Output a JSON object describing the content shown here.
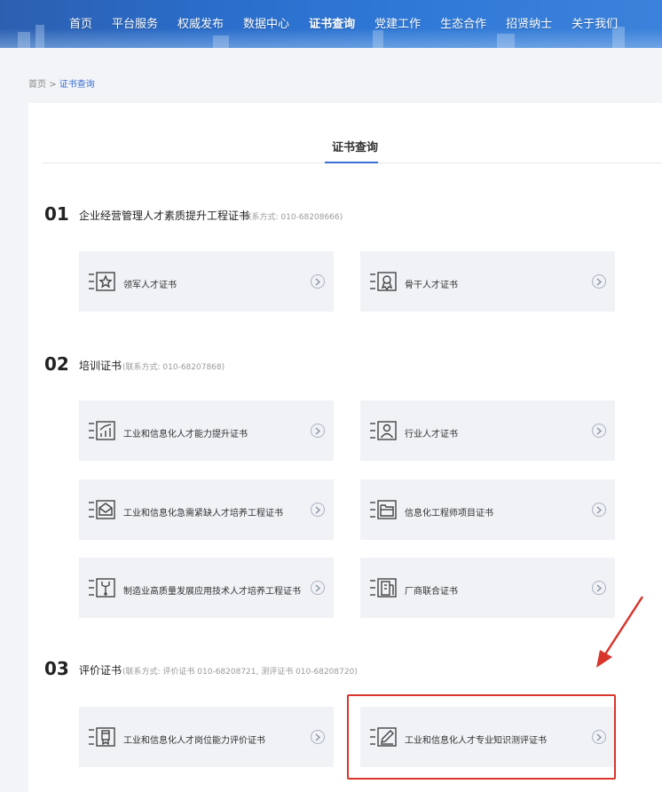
{
  "nav": {
    "items": [
      "首页",
      "平台服务",
      "权威发布",
      "数据中心",
      "证书查询",
      "党建工作",
      "生态合作",
      "招贤纳士",
      "关于我们"
    ],
    "active_index": 4
  },
  "breadcrumb": {
    "home": "首页",
    "sep": ">",
    "current": "证书查询"
  },
  "page_title": "证书查询",
  "sections": [
    {
      "num": "01",
      "title": "企业经营管理人才素质提升工程证书",
      "contact": "(联系方式: 010-68208666)",
      "cards": [
        {
          "label": "领军人才证书",
          "icon": "star-certificate-icon"
        },
        {
          "label": "骨干人才证书",
          "icon": "award-certificate-icon"
        }
      ]
    },
    {
      "num": "02",
      "title": "培训证书",
      "contact": "(联系方式: 010-68207868)",
      "cards": [
        {
          "label": "工业和信息化人才能力提升证书",
          "icon": "growth-chart-icon"
        },
        {
          "label": "行业人才证书",
          "icon": "person-icon"
        },
        {
          "label": "工业和信息化急需紧缺人才培养工程证书",
          "icon": "envelope-icon"
        },
        {
          "label": "信息化工程师项目证书",
          "icon": "folder-icon"
        },
        {
          "label": "制造业高质量发展应用技术人才培养工程证书",
          "icon": "wrench-icon"
        },
        {
          "label": "厂商联合证书",
          "icon": "building-icon"
        }
      ]
    },
    {
      "num": "03",
      "title": "评价证书",
      "contact": "(联系方式: 评价证书 010-68208721, 测评证书 010-68208720)",
      "cards": [
        {
          "label": "工业和信息化人才岗位能力评价证书",
          "icon": "badge-icon"
        },
        {
          "label": "工业和信息化人才专业知识测评证书",
          "icon": "pen-icon"
        }
      ]
    }
  ],
  "colors": {
    "nav_bg": "#2a6cc9",
    "accent": "#3b6fd6",
    "card_bg": "#f0f2f6",
    "highlight": "#d8352c"
  }
}
